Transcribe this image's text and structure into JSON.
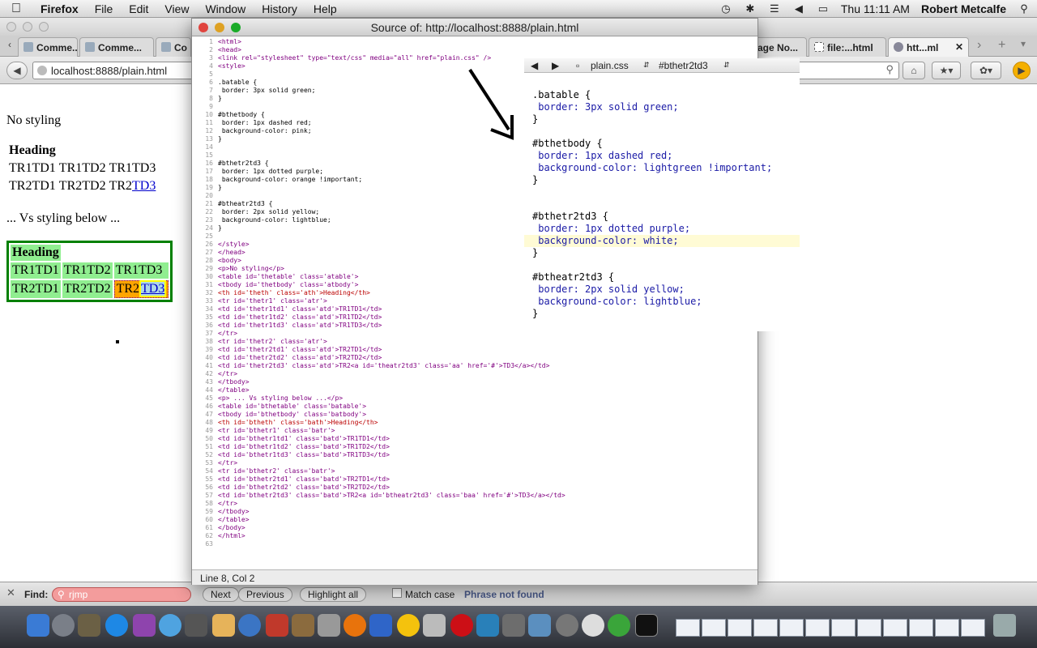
{
  "menubar": {
    "app_name": "Firefox",
    "items": [
      "File",
      "Edit",
      "View",
      "Window",
      "History",
      "Help"
    ],
    "clock": "Thu 11:11 AM",
    "user": "Robert Metcalfe"
  },
  "browser": {
    "tabs": [
      "Comme...",
      "Comme...",
      "Co",
      "age No...",
      "file:...html",
      "htt...ml"
    ],
    "url": "localhost:8888/plain.html"
  },
  "page": {
    "p1": "No styling",
    "plain_table": {
      "heading": "Heading",
      "r1": [
        "TR1TD1",
        "TR1TD2",
        "TR1TD3"
      ],
      "r2": [
        "TR2TD1",
        "TR2TD2",
        "TR2"
      ],
      "link": "TD3"
    },
    "p2": "... Vs styling below ...",
    "styled_table": {
      "heading": "Heading",
      "r1": [
        "TR1TD1",
        "TR1TD2",
        "TR1TD3"
      ],
      "r2": [
        "TR2TD1",
        "TR2TD2",
        "TR2"
      ],
      "link": "TD3"
    }
  },
  "findbar": {
    "label": "Find:",
    "value": "rjmp",
    "next": "Next",
    "previous": "Previous",
    "highlight_all": "Highlight all",
    "match_case": "Match case",
    "status": "Phrase not found"
  },
  "source_window": {
    "title": "Source of: http://localhost:8888/plain.html",
    "status": "Line 8, Col 2",
    "lines": [
      "<html>",
      "<head>",
      "<link rel=\"stylesheet\" type=\"text/css\" media=\"all\" href=\"plain.css\" />",
      "<style>",
      "",
      ".batable {",
      " border: 3px solid green;",
      "}",
      "",
      "#bthetbody {",
      " border: 1px dashed red;",
      " background-color: pink;",
      "}",
      "",
      "",
      "#bthetr2td3 {",
      " border: 1px dotted purple;",
      " background-color: orange !important;",
      "}",
      "",
      "#btheatr2td3 {",
      " border: 2px solid yellow;",
      " background-color: lightblue;",
      "}",
      "",
      "</style>",
      "</head>",
      "<body>",
      "<p>No styling</p>",
      "<table id='thetable' class='atable'>",
      "<tbody id='thetbody' class='atbody'>",
      "<th id='theth' class='ath'>Heading</th>",
      "<tr id='thetr1' class='atr'>",
      "<td id='thetr1td1' class='atd'>TR1TD1</td>",
      "<td id='thetr1td2' class='atd'>TR1TD2</td>",
      "<td id='thetr1td3' class='atd'>TR1TD3</td>",
      "</tr>",
      "<tr id='thetr2' class='atr'>",
      "<td id='thetr2td1' class='atd'>TR2TD1</td>",
      "<td id='thetr2td2' class='atd'>TR2TD2</td>",
      "<td id='thetr2td3' class='atd'>TR2<a id='theatr2td3' class='aa' href='#'>TD3</a></td>",
      "</tr>",
      "</tbody>",
      "</table>",
      "<p> ... Vs styling below ...</p>",
      "<table id='bthetable' class='batable'>",
      "<tbody id='bthetbody' class='batbody'>",
      "<th id='btheth' class='bath'>Heading</th>",
      "<tr id='bthetr1' class='batr'>",
      "<td id='bthetr1td1' class='batd'>TR1TD1</td>",
      "<td id='bthetr1td2' class='batd'>TR1TD2</td>",
      "<td id='bthetr1td3' class='batd'>TR1TD3</td>",
      "</tr>",
      "<tr id='bthetr2' class='batr'>",
      "<td id='bthetr2td1' class='batd'>TR2TD1</td>",
      "<td id='bthetr2td2' class='batd'>TR2TD2</td>",
      "<td id='bthetr2td3' class='batd'>TR2<a id='btheatr2td3' class='baa' href='#'>TD3</a></td>",
      "</tr>",
      "</tbody>",
      "</table>",
      "</body>",
      "</html>",
      ""
    ]
  },
  "css_editor": {
    "file": "plain.css",
    "selector": "#bthetr2td3",
    "lines": [
      ".batable {",
      " border: 3px solid green;",
      "}",
      "",
      "#bthetbody {",
      " border: 1px dashed red;",
      " background-color: lightgreen !important;",
      "}",
      "",
      "",
      "#bthetr2td3 {",
      " border: 1px dotted purple;",
      " background-color: white;",
      "}",
      "",
      "#btheatr2td3 {",
      " border: 2px solid yellow;",
      " background-color: lightblue;",
      "}"
    ]
  }
}
